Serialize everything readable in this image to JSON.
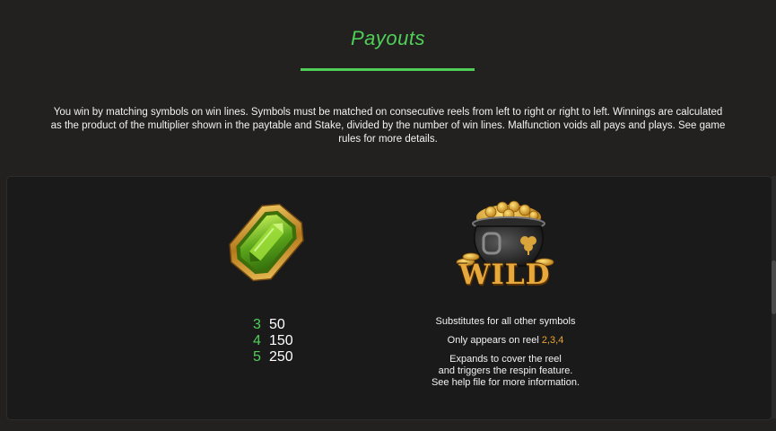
{
  "header": {
    "title": "Payouts",
    "description": "You win by matching symbols on win lines. Symbols must be matched on consecutive reels from left to right or right to left. Winnings are calculated as the product of the multiplier shown in the paytable and Stake, divided by the number of win lines. Malfunction voids all pays and plays. See game rules for more details."
  },
  "gem_symbol": {
    "icon": "green-gem-icon",
    "pays": [
      {
        "count": "3",
        "value": "50"
      },
      {
        "count": "4",
        "value": "150"
      },
      {
        "count": "5",
        "value": "250"
      }
    ]
  },
  "wild_symbol": {
    "icon": "pot-of-gold-icon",
    "label": "WILD",
    "line1": "Substitutes for all other symbols",
    "line2_prefix": "Only appears on reel ",
    "line2_reels": "2,3,4",
    "line3": "Expands to cover the reel",
    "line4": "and triggers the respin feature.",
    "line5": "See help file for more information."
  },
  "colors": {
    "accent": "#4fcf57",
    "reel_highlight": "#e9a531",
    "background": "#222120"
  }
}
